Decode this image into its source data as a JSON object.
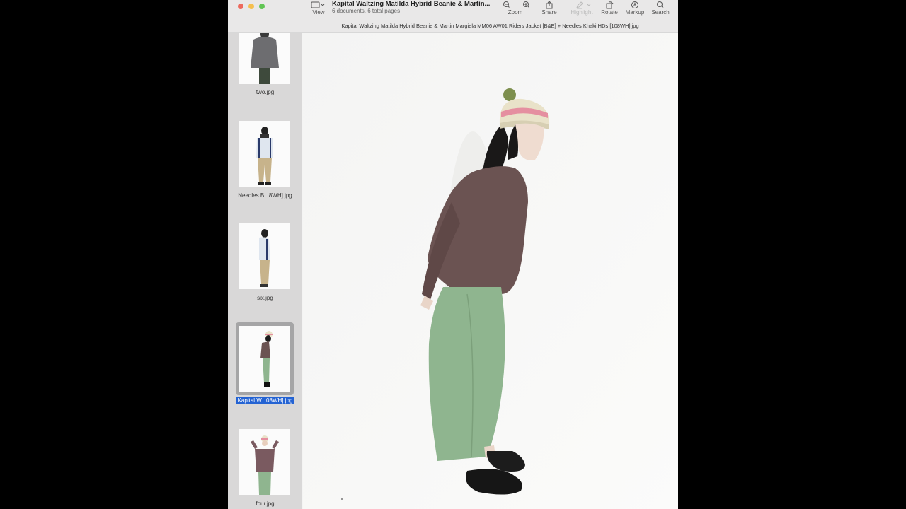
{
  "toolbar": {
    "view_label": "View",
    "title": "Kapital Waltzing Matilda Hybrid Beanie & Martin...",
    "subtitle": "6 documents, 6 total pages",
    "zoom_label": "Zoom",
    "share_label": "Share",
    "highlight_label": "Highlight",
    "rotate_label": "Rotate",
    "markup_label": "Markup",
    "search_label": "Search"
  },
  "filename": "Kapital Waltzing Matilda Hybrid Beanie & Martin Margiela MM06 AW01 Riders Jacket [B&E] + Needles Khaki HDs [108WH].jpg",
  "sidebar": {
    "items": [
      {
        "caption": "two.jpg"
      },
      {
        "caption": "Needles B...8WH].jpg"
      },
      {
        "caption": "six.jpg"
      },
      {
        "caption": "Kapital W...08WH].jpg",
        "selected": true
      },
      {
        "caption": "four.jpg"
      }
    ]
  },
  "colors": {
    "selection": "#2463d3",
    "jacket": "#6b5352",
    "pants": "#8fb58f",
    "beanie": "#e9e2c9",
    "beanie_stripe": "#e58fa0"
  },
  "icons": [
    "sidebar-icon",
    "zoom-out-icon",
    "zoom-in-icon",
    "share-icon",
    "highlight-icon",
    "rotate-icon",
    "markup-icon",
    "search-icon"
  ]
}
